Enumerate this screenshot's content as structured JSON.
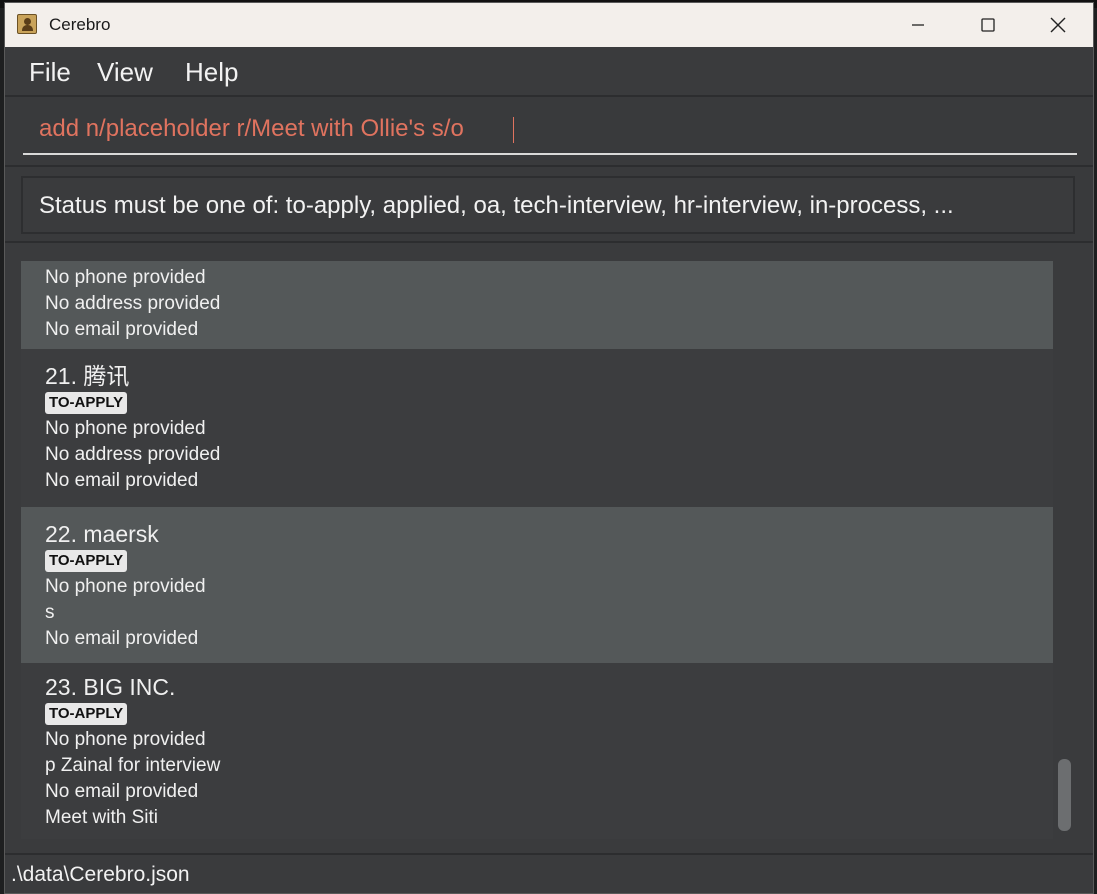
{
  "window": {
    "title": "Cerebro",
    "controls": {
      "minimize": "minimize",
      "maximize": "maximize",
      "close": "close"
    }
  },
  "menu": {
    "file": "File",
    "view": "View",
    "help": "Help"
  },
  "command": {
    "value": "add n/placeholder r/Meet with Ollie's s/o"
  },
  "result": {
    "message": "Status must be one of: to-apply, applied, oa, tech-interview, hr-interview, in-process, ..."
  },
  "cards": [
    {
      "title": "",
      "tag": "",
      "fields": [
        "No phone provided",
        "No address provided",
        "No email provided"
      ]
    },
    {
      "title": "21. 腾讯",
      "tag": "TO-APPLY",
      "fields": [
        "No phone provided",
        "No address provided",
        "No email provided"
      ]
    },
    {
      "title": "22. maersk",
      "tag": "TO-APPLY",
      "fields": [
        "No phone provided",
        "s",
        "No email provided"
      ]
    },
    {
      "title": "23. BIG INC.",
      "tag": "TO-APPLY",
      "fields": [
        "No phone provided",
        "p Zainal for interview",
        "No email provided",
        "Meet with Siti"
      ]
    }
  ],
  "status_bar": {
    "path": ".\\data\\Cerebro.json"
  }
}
